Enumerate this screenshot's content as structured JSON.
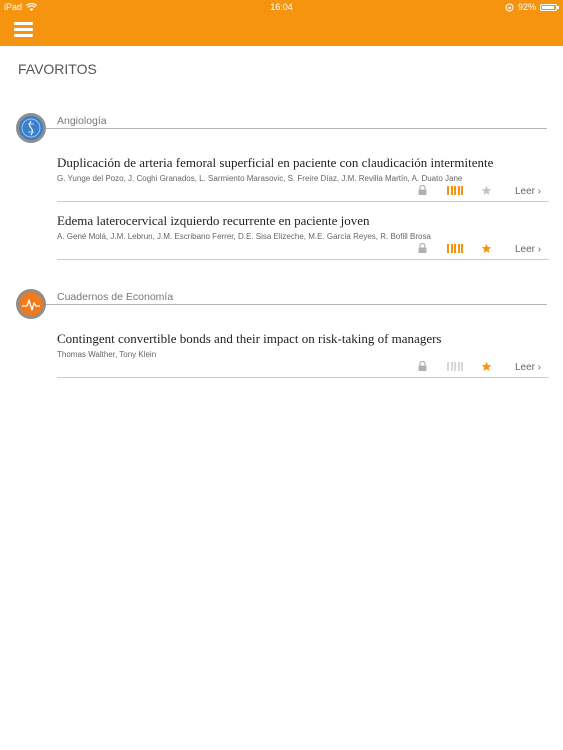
{
  "status_bar": {
    "device": "iPad",
    "time": "16:04",
    "battery": "92%",
    "battery_level": 0.92
  },
  "nav": {
    "menu_icon": "hamburger-menu-icon"
  },
  "page": {
    "title": "FAVORITOS"
  },
  "colors": {
    "accent": "#f7940f",
    "bar_on": "#f7940f",
    "bar_off": "#d8d8d8",
    "star_on": "#f7940f",
    "star_off": "#c4c4c4",
    "angiologia_icon": "#3a7fc7",
    "economia_icon": "#f07a1e"
  },
  "sections": [
    {
      "label": "Angiología",
      "icon": "angiologia-journal-icon",
      "articles": [
        {
          "title": "Duplicación de arteria femoral superficial en paciente con claudicación intermitente",
          "authors": "G. Yunge del Pozo, J. Coghi Granados, L. Sarmiento Marasovic, S. Freire Díaz, J.M. Revilla Martín, A. Duato Jane",
          "locked": true,
          "level": 5,
          "favorite": false,
          "read_label": "Leer"
        },
        {
          "title": "Edema laterocervical izquierdo recurrente en paciente joven",
          "authors": "A. Gené Molá, J.M. Lebrun, J.M. Escribano Ferrer, D.E. Sisa Elizeche, M.E. García Reyes, R. Bofill Brosa",
          "locked": true,
          "level": 5,
          "favorite": true,
          "read_label": "Leer"
        }
      ]
    },
    {
      "label": "Cuadernos de Economía",
      "icon": "economia-journal-icon",
      "articles": [
        {
          "title": "Contingent convertible bonds and their impact on risk-taking of managers",
          "authors": "Thomas Walther, Tony Klein",
          "locked": true,
          "level": 0,
          "favorite": true,
          "read_label": "Leer"
        }
      ]
    }
  ]
}
